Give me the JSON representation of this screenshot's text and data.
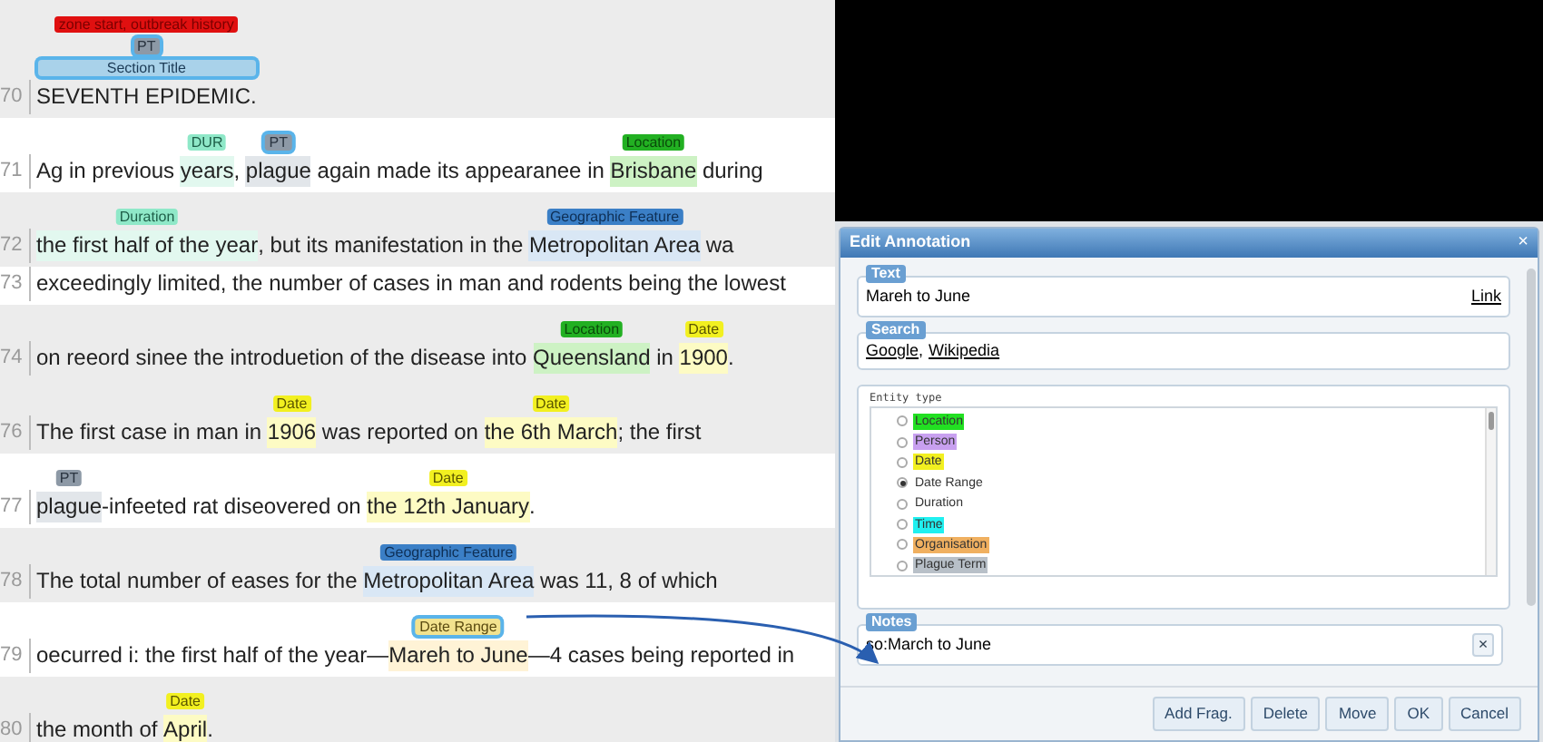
{
  "document": {
    "rows": [
      {
        "number": "70",
        "shaded": true,
        "segments": [
          {
            "text": "SEVENTH EPIDEMIC.",
            "annotations": [
              {
                "label": "zone start, outbreak history",
                "kind": "zone",
                "selected": false
              },
              {
                "label": "PT",
                "kind": "plague_term",
                "selected": true
              },
              {
                "label": "Section Title",
                "kind": "section_title",
                "selected": true
              }
            ]
          }
        ]
      },
      {
        "number": "71",
        "shaded": false,
        "segments": [
          {
            "text": "Ag in previous "
          },
          {
            "text": "years",
            "annotations": [
              {
                "label": "DUR",
                "kind": "duration",
                "selected": false
              }
            ]
          },
          {
            "text": ", "
          },
          {
            "text": "plague",
            "annotations": [
              {
                "label": "PT",
                "kind": "plague_term",
                "selected": true
              }
            ]
          },
          {
            "text": " again made its appearanee in "
          },
          {
            "text": "Brisbane",
            "annotations": [
              {
                "label": "Location",
                "kind": "location",
                "selected": false
              }
            ]
          },
          {
            "text": " during"
          }
        ]
      },
      {
        "number": "72",
        "shaded": true,
        "segments": [
          {
            "text": "the first half of the year",
            "annotations": [
              {
                "label": "Duration",
                "kind": "duration",
                "selected": false
              }
            ]
          },
          {
            "text": ", but its manifestation in the "
          },
          {
            "text": "Metropolitan Area",
            "annotations": [
              {
                "label": "Geographic Feature",
                "kind": "geographic_feature",
                "selected": false
              }
            ]
          },
          {
            "text": " wa"
          }
        ]
      },
      {
        "number": "73",
        "shaded": false,
        "segments": [
          {
            "text": "exceedingly limited, the number of cases in man and rodents being the lowest"
          }
        ]
      },
      {
        "number": "74",
        "shaded": true,
        "segments": [
          {
            "text": "on reeord sinee the introduetion of the disease into "
          },
          {
            "text": "Queensland",
            "annotations": [
              {
                "label": "Location",
                "kind": "location",
                "selected": false
              }
            ]
          },
          {
            "text": " in "
          },
          {
            "text": "1900",
            "annotations": [
              {
                "label": "Date",
                "kind": "date",
                "selected": false
              }
            ]
          },
          {
            "text": "."
          }
        ]
      },
      {
        "number": "76",
        "shaded": true,
        "segments": [
          {
            "text": "The first case in man in "
          },
          {
            "text": "1906",
            "annotations": [
              {
                "label": "Date",
                "kind": "date",
                "selected": false
              }
            ]
          },
          {
            "text": " was reported on "
          },
          {
            "text": "the 6th March",
            "annotations": [
              {
                "label": "Date",
                "kind": "date",
                "selected": false
              }
            ]
          },
          {
            "text": "; the first"
          }
        ]
      },
      {
        "number": "77",
        "shaded": false,
        "segments": [
          {
            "text": "plague",
            "annotations": [
              {
                "label": "PT",
                "kind": "plague_term",
                "selected": false
              }
            ]
          },
          {
            "text": "-infeeted rat diseovered on "
          },
          {
            "text": "the 12th January",
            "annotations": [
              {
                "label": "Date",
                "kind": "date",
                "selected": false
              }
            ]
          },
          {
            "text": "."
          }
        ]
      },
      {
        "number": "78",
        "shaded": true,
        "segments": [
          {
            "text": "The total number of eases for the "
          },
          {
            "text": "Metropolitan Area",
            "annotations": [
              {
                "label": "Geographic Feature",
                "kind": "geographic_feature",
                "selected": false
              }
            ]
          },
          {
            "text": " was 11, 8 of which"
          }
        ]
      },
      {
        "number": "79",
        "shaded": false,
        "segments": [
          {
            "text": "oecurred i: the first half of the year—"
          },
          {
            "text": "Mareh to June",
            "annotations": [
              {
                "label": "Date Range",
                "kind": "date_range",
                "selected": true
              }
            ]
          },
          {
            "text": "—4 cases being reported in"
          }
        ]
      },
      {
        "number": "80",
        "shaded": true,
        "segments": [
          {
            "text": "the month of "
          },
          {
            "text": "April",
            "annotations": [
              {
                "label": "Date",
                "kind": "date",
                "selected": false
              }
            ]
          },
          {
            "text": "."
          }
        ]
      }
    ]
  },
  "dialog": {
    "title": "Edit Annotation",
    "close": "×",
    "text_section": {
      "legend": "Text",
      "value": "Mareh to June",
      "link": "Link"
    },
    "search_section": {
      "legend": "Search",
      "links": [
        "Google",
        "Wikipedia"
      ],
      "separator": ","
    },
    "entity_section": {
      "legend": "Entity type",
      "types": [
        {
          "label": "Location",
          "kind": "location",
          "selected": false
        },
        {
          "label": "Person",
          "kind": "person",
          "selected": false
        },
        {
          "label": "Date",
          "kind": "date",
          "selected": false
        },
        {
          "label": "Date Range",
          "kind": "date_range",
          "selected": true
        },
        {
          "label": "Duration",
          "kind": "duration",
          "selected": false
        },
        {
          "label": "Time",
          "kind": "time",
          "selected": false
        },
        {
          "label": "Organisation",
          "kind": "organisation",
          "selected": false
        },
        {
          "label": "Plague Term",
          "kind": "plague_term",
          "selected": false
        }
      ]
    },
    "notes_section": {
      "legend": "Notes",
      "value": "so:March to June",
      "clear": "×"
    },
    "buttons": [
      "Add Frag.",
      "Delete",
      "Move",
      "OK",
      "Cancel"
    ]
  }
}
